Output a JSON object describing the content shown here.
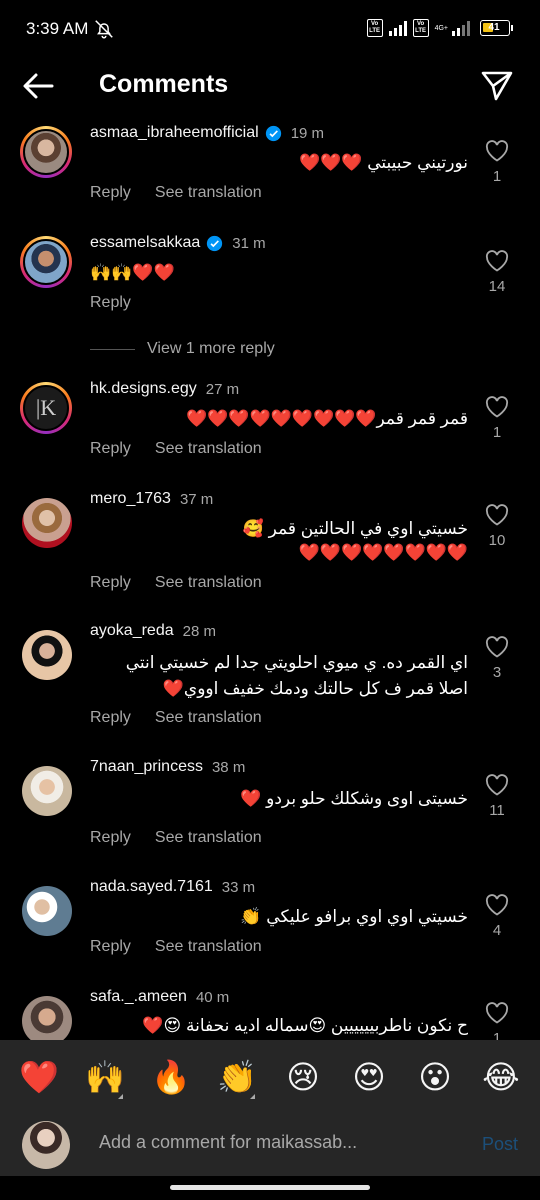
{
  "status_bar": {
    "time": "3:39 AM",
    "battery": "41",
    "network": "4G+",
    "lte": "Vo LTE"
  },
  "header": {
    "title": "Comments"
  },
  "comments": [
    {
      "username": "asmaa_ibraheemofficial",
      "verified": true,
      "time": "19 m",
      "text": "نورتيني حبيبتي ❤️❤️❤️",
      "reply": "Reply",
      "translate": "See translation",
      "likes": "1",
      "ring": true
    },
    {
      "username": "essamelsakkaa",
      "verified": true,
      "time": "31 m",
      "text": "🙌🙌❤️❤️",
      "reply": "Reply",
      "likes": "14",
      "ring": true
    },
    {
      "username": "hk.designs.egy",
      "time": "27 m",
      "text": "قمر قمر قمر❤️❤️❤️❤️❤️❤️❤️❤️❤️",
      "reply": "Reply",
      "translate": "See translation",
      "likes": "1",
      "ring": true
    },
    {
      "username": "mero_1763",
      "time": "37 m",
      "text_lines": [
        "خسيتي اوي  في الحالتين قمر 🥰",
        "❤️❤️❤️❤️❤️❤️❤️❤️"
      ],
      "reply": "Reply",
      "translate": "See translation",
      "likes": "10"
    },
    {
      "username": "ayoka_reda",
      "time": "28 m",
      "text_lines": [
        "اي القمر ده. ي ميوي احلويتي جدا لم خسيتي انتي",
        "اصلا قمر ف كل حالتك ودمك خفيف اووي❤️"
      ],
      "reply": "Reply",
      "translate": "See translation",
      "likes": "3"
    },
    {
      "username": "7naan_princess",
      "time": "38 m",
      "text": "خسيتى اوى وشكلك حلو بردو ❤️",
      "reply": "Reply",
      "translate": "See translation",
      "likes": "11"
    },
    {
      "username": "nada.sayed.7161",
      "time": "33 m",
      "text": "خسيتي اوي اوي برافو عليكي 👏",
      "reply": "Reply",
      "translate": "See translation",
      "likes": "4"
    },
    {
      "username": "safa._.ameen",
      "time": "40 m",
      "text": "ح نكون ناطربيييييين 😍سماله اديه نحفانة 😍❤️",
      "likes": "1"
    }
  ],
  "view_more": "View 1 more reply",
  "quick_reactions": [
    "❤️",
    "🙌",
    "🔥",
    "👏",
    "😢",
    "😍",
    "😮",
    "😂"
  ],
  "input": {
    "placeholder": "Add a comment for maikassab...",
    "post_label": "Post"
  },
  "icons": {
    "back": "arrow-left-icon",
    "share": "paper-plane-icon",
    "like": "heart-outline-icon",
    "verified": "verified-badge-icon"
  },
  "colors": {
    "background": "#000000",
    "verified": "#0095f6",
    "post_disabled": "#1c4f7a",
    "bar": "#262626"
  }
}
